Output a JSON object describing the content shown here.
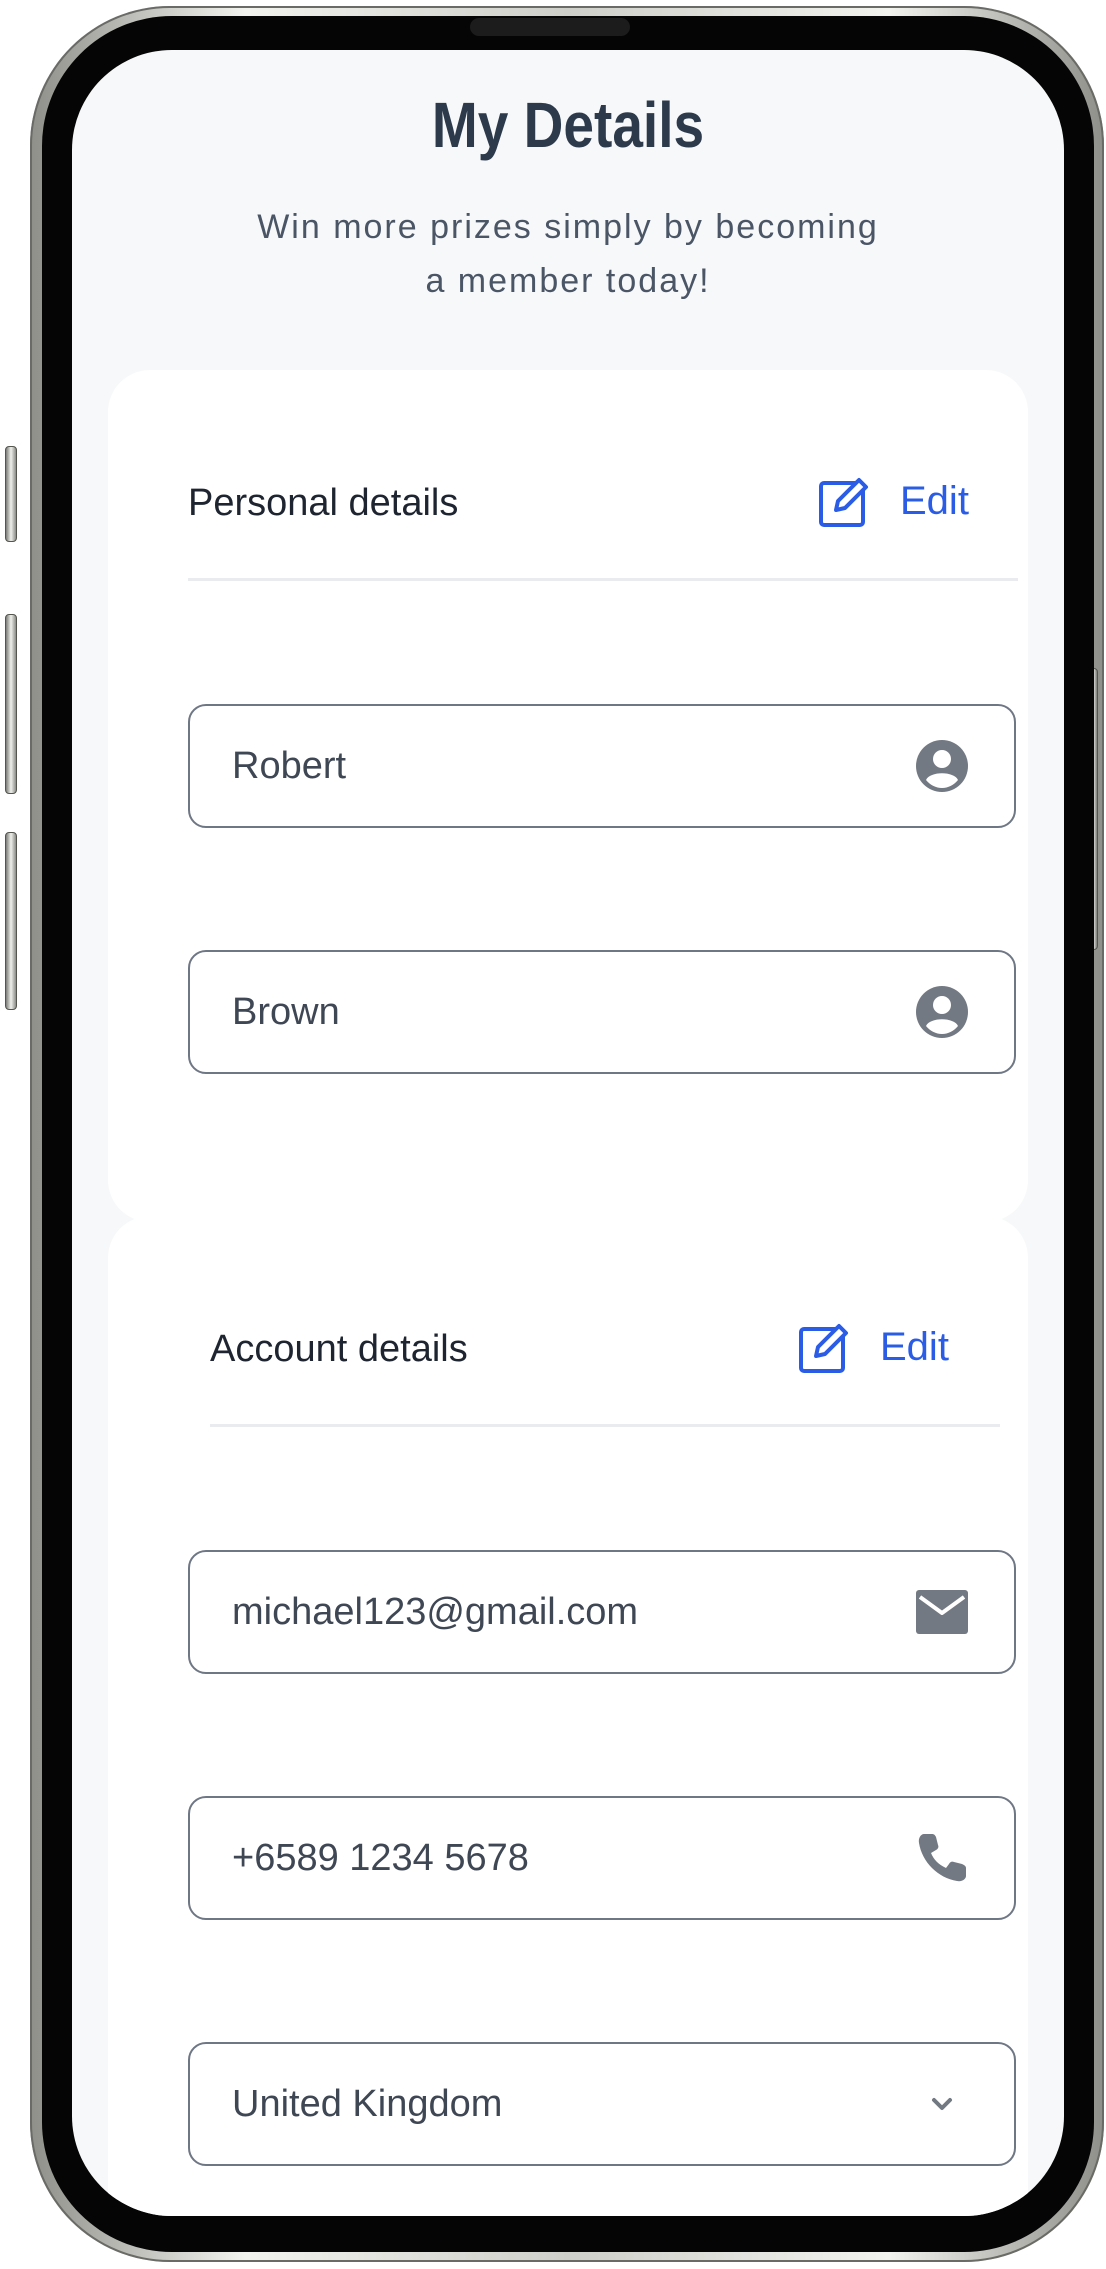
{
  "header": {
    "title": "My Details",
    "subtitle_line1": "Win more prizes simply by becoming",
    "subtitle_line2": "a member today!"
  },
  "personal": {
    "title": "Personal details",
    "edit_label": "Edit",
    "first_name": "Robert",
    "last_name": "Brown"
  },
  "account": {
    "title": "Account details",
    "edit_label": "Edit",
    "email": "michael123@gmail.com",
    "phone": "+6589 1234 5678",
    "country": "United Kingdom"
  },
  "icons": {
    "edit": "edit-icon",
    "user": "user-icon",
    "email": "email-icon",
    "phone": "phone-icon",
    "dropdown": "chevron-down-icon"
  },
  "colors": {
    "accent": "#2a5ce6",
    "title": "#2c3a4b",
    "icon": "#737982"
  }
}
